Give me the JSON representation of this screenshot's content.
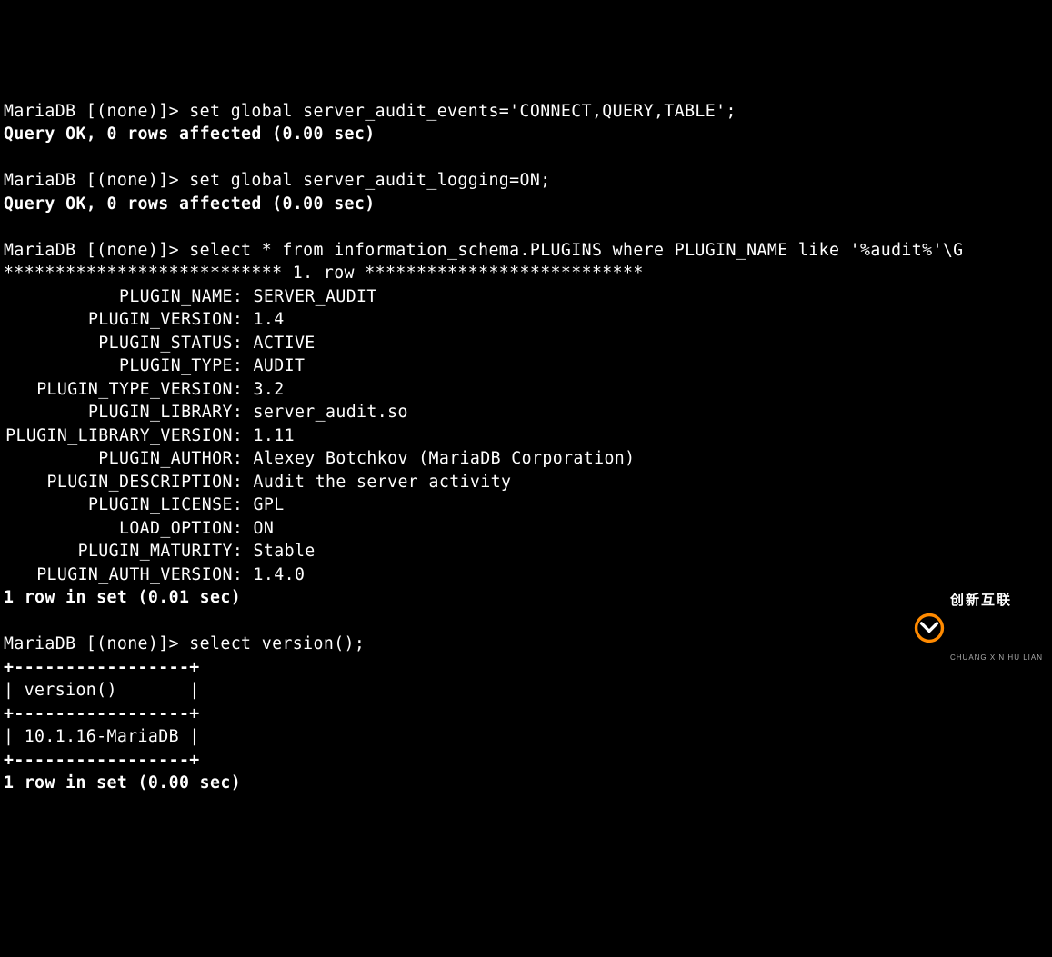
{
  "prompt": "MariaDB [(none)]> ",
  "cmd1": "set global server_audit_events='CONNECT,QUERY,TABLE';",
  "ok1": "Query OK, 0 rows affected (0.00 sec)",
  "cmd2": "set global server_audit_logging=ON;",
  "ok2": "Query OK, 0 rows affected (0.00 sec)",
  "cmd3": "select * from information_schema.PLUGINS where PLUGIN_NAME like '%audit%'\\G",
  "row_header": "*************************** 1. row ***************************",
  "fields": [
    {
      "k": "PLUGIN_NAME",
      "v": "SERVER_AUDIT"
    },
    {
      "k": "PLUGIN_VERSION",
      "v": "1.4"
    },
    {
      "k": "PLUGIN_STATUS",
      "v": "ACTIVE"
    },
    {
      "k": "PLUGIN_TYPE",
      "v": "AUDIT"
    },
    {
      "k": "PLUGIN_TYPE_VERSION",
      "v": "3.2"
    },
    {
      "k": "PLUGIN_LIBRARY",
      "v": "server_audit.so"
    },
    {
      "k": "PLUGIN_LIBRARY_VERSION",
      "v": "1.11"
    },
    {
      "k": "PLUGIN_AUTHOR",
      "v": "Alexey Botchkov (MariaDB Corporation)"
    },
    {
      "k": "PLUGIN_DESCRIPTION",
      "v": "Audit the server activity"
    },
    {
      "k": "PLUGIN_LICENSE",
      "v": "GPL"
    },
    {
      "k": "LOAD_OPTION",
      "v": "ON"
    },
    {
      "k": "PLUGIN_MATURITY",
      "v": "Stable"
    },
    {
      "k": "PLUGIN_AUTH_VERSION",
      "v": "1.4.0"
    }
  ],
  "set1": "1 row in set (0.01 sec)",
  "cmd4": "select version();",
  "table": {
    "border": "+-----------------+",
    "header": "| version()       |",
    "row": "| 10.1.16-MariaDB |"
  },
  "set2": "1 row in set (0.00 sec)",
  "watermark": {
    "cn": "创新互联",
    "en": "CHUANG XIN HU LIAN"
  }
}
